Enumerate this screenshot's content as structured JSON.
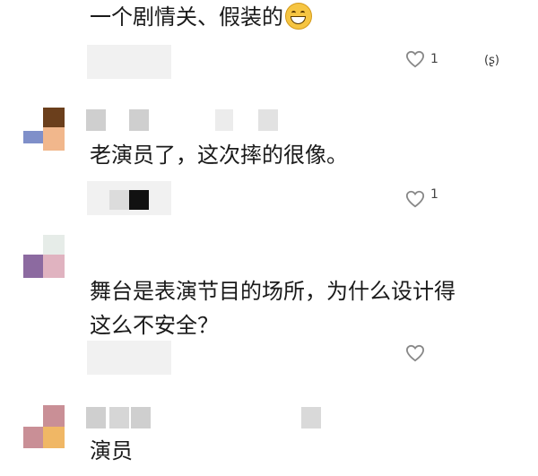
{
  "comments": [
    {
      "text": "一个剧情关、假装的",
      "like_count": "1",
      "reply_icon_text": "(ʂ)"
    },
    {
      "text": "老演员了，这次摔的很像。",
      "like_count": "1"
    },
    {
      "text_line1": "舞台是表演节目的场所，为什么设计得",
      "text_line2": "这么不安全？"
    },
    {
      "text": "演员"
    }
  ],
  "icons": {
    "like": "heart-like-icon",
    "emoji": "grinning-face-emoji-icon",
    "reply": "reply-bubble-icon"
  },
  "colors": {
    "avatar1_a": "#6b3f1c",
    "avatar1_b": "#f1b78c",
    "avatar1_c": "#7f8fc9",
    "avatar3_a": "#8c6aa0",
    "avatar3_b": "#e0b3c0",
    "avatar4_a": "#c98f96",
    "avatar4_b": "#f0b765"
  }
}
